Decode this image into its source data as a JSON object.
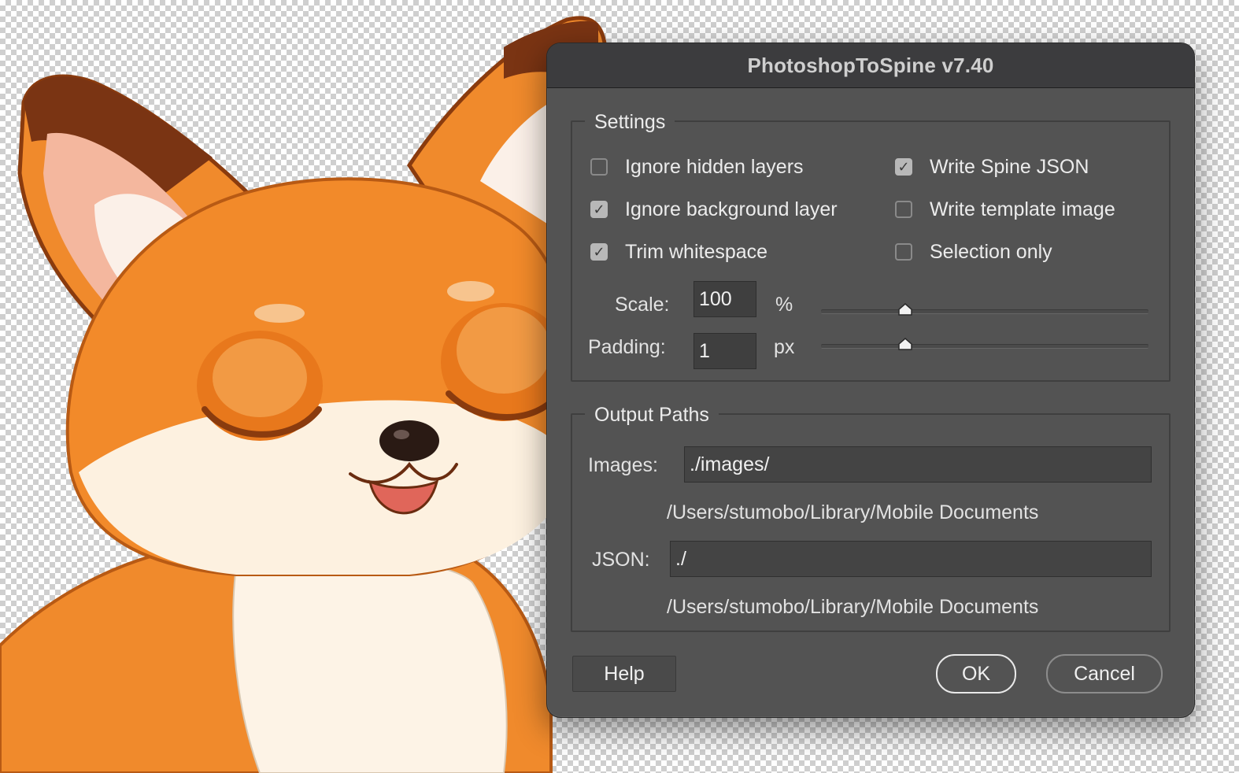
{
  "dialog": {
    "title": "PhotoshopToSpine v7.40"
  },
  "settings": {
    "group_label": "Settings",
    "ignore_hidden_layers": {
      "label": "Ignore hidden layers",
      "checked": false
    },
    "ignore_background_layer": {
      "label": "Ignore background layer",
      "checked": true
    },
    "trim_whitespace": {
      "label": "Trim whitespace",
      "checked": true
    },
    "write_spine_json": {
      "label": "Write Spine JSON",
      "checked": true
    },
    "write_template_image": {
      "label": "Write template image",
      "checked": false
    },
    "selection_only": {
      "label": "Selection only",
      "checked": false
    },
    "scale": {
      "label": "Scale:",
      "value": "100",
      "unit": "%"
    },
    "padding": {
      "label": "Padding:",
      "value": "1",
      "unit": "px"
    }
  },
  "output": {
    "group_label": "Output Paths",
    "images_label": "Images:",
    "images_value": "./images/",
    "images_resolved": "/Users/stumobo/Library/Mobile Documents",
    "json_label": "JSON:",
    "json_value": "./",
    "json_resolved": "/Users/stumobo/Library/Mobile Documents"
  },
  "buttons": {
    "help": "Help",
    "ok": "OK",
    "cancel": "Cancel"
  },
  "colors": {
    "dialog_bg": "#535353",
    "titlebar_bg": "#3c3c3e",
    "fox_orange": "#f28a2a",
    "fox_cream": "#fdf1e0"
  }
}
